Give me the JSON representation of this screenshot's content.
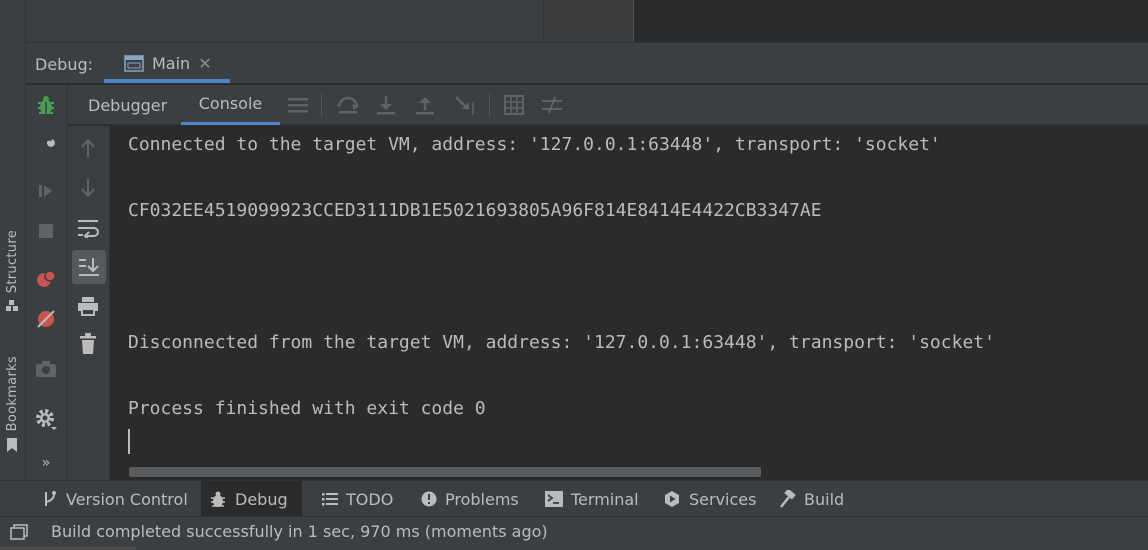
{
  "debug_panel": {
    "label": "Debug:",
    "run_tab": "Main",
    "sub_tabs": [
      "Debugger",
      "Console"
    ]
  },
  "left_stripe": {
    "structure": "Structure",
    "bookmarks": "Bookmarks"
  },
  "console": {
    "lines": [
      "Connected to the target VM, address: '127.0.0.1:63448', transport: 'socket'",
      "CF032EE4519099923CCED3111DB1E5021693805A96F814E8414E4422CB3347AE",
      "Disconnected from the target VM, address: '127.0.0.1:63448', transport: 'socket'",
      "Process finished with exit code 0"
    ]
  },
  "bottom_tabs": [
    {
      "label": "Version Control",
      "icon": "branch-icon"
    },
    {
      "label": "Debug",
      "icon": "bug-icon"
    },
    {
      "label": "TODO",
      "icon": "list-icon"
    },
    {
      "label": "Problems",
      "icon": "warning-icon"
    },
    {
      "label": "Terminal",
      "icon": "terminal-icon"
    },
    {
      "label": "Services",
      "icon": "play-circle-icon"
    },
    {
      "label": "Build",
      "icon": "hammer-icon"
    }
  ],
  "status": {
    "message": "Build completed successfully in 1 sec, 970 ms (moments ago)"
  },
  "colors": {
    "accent": "#4a88c7",
    "panel": "#3c3f41",
    "background": "#2b2b2b",
    "text": "#bbbbbb",
    "debug_green": "#499c54",
    "breakpoint_red": "#c75450"
  }
}
